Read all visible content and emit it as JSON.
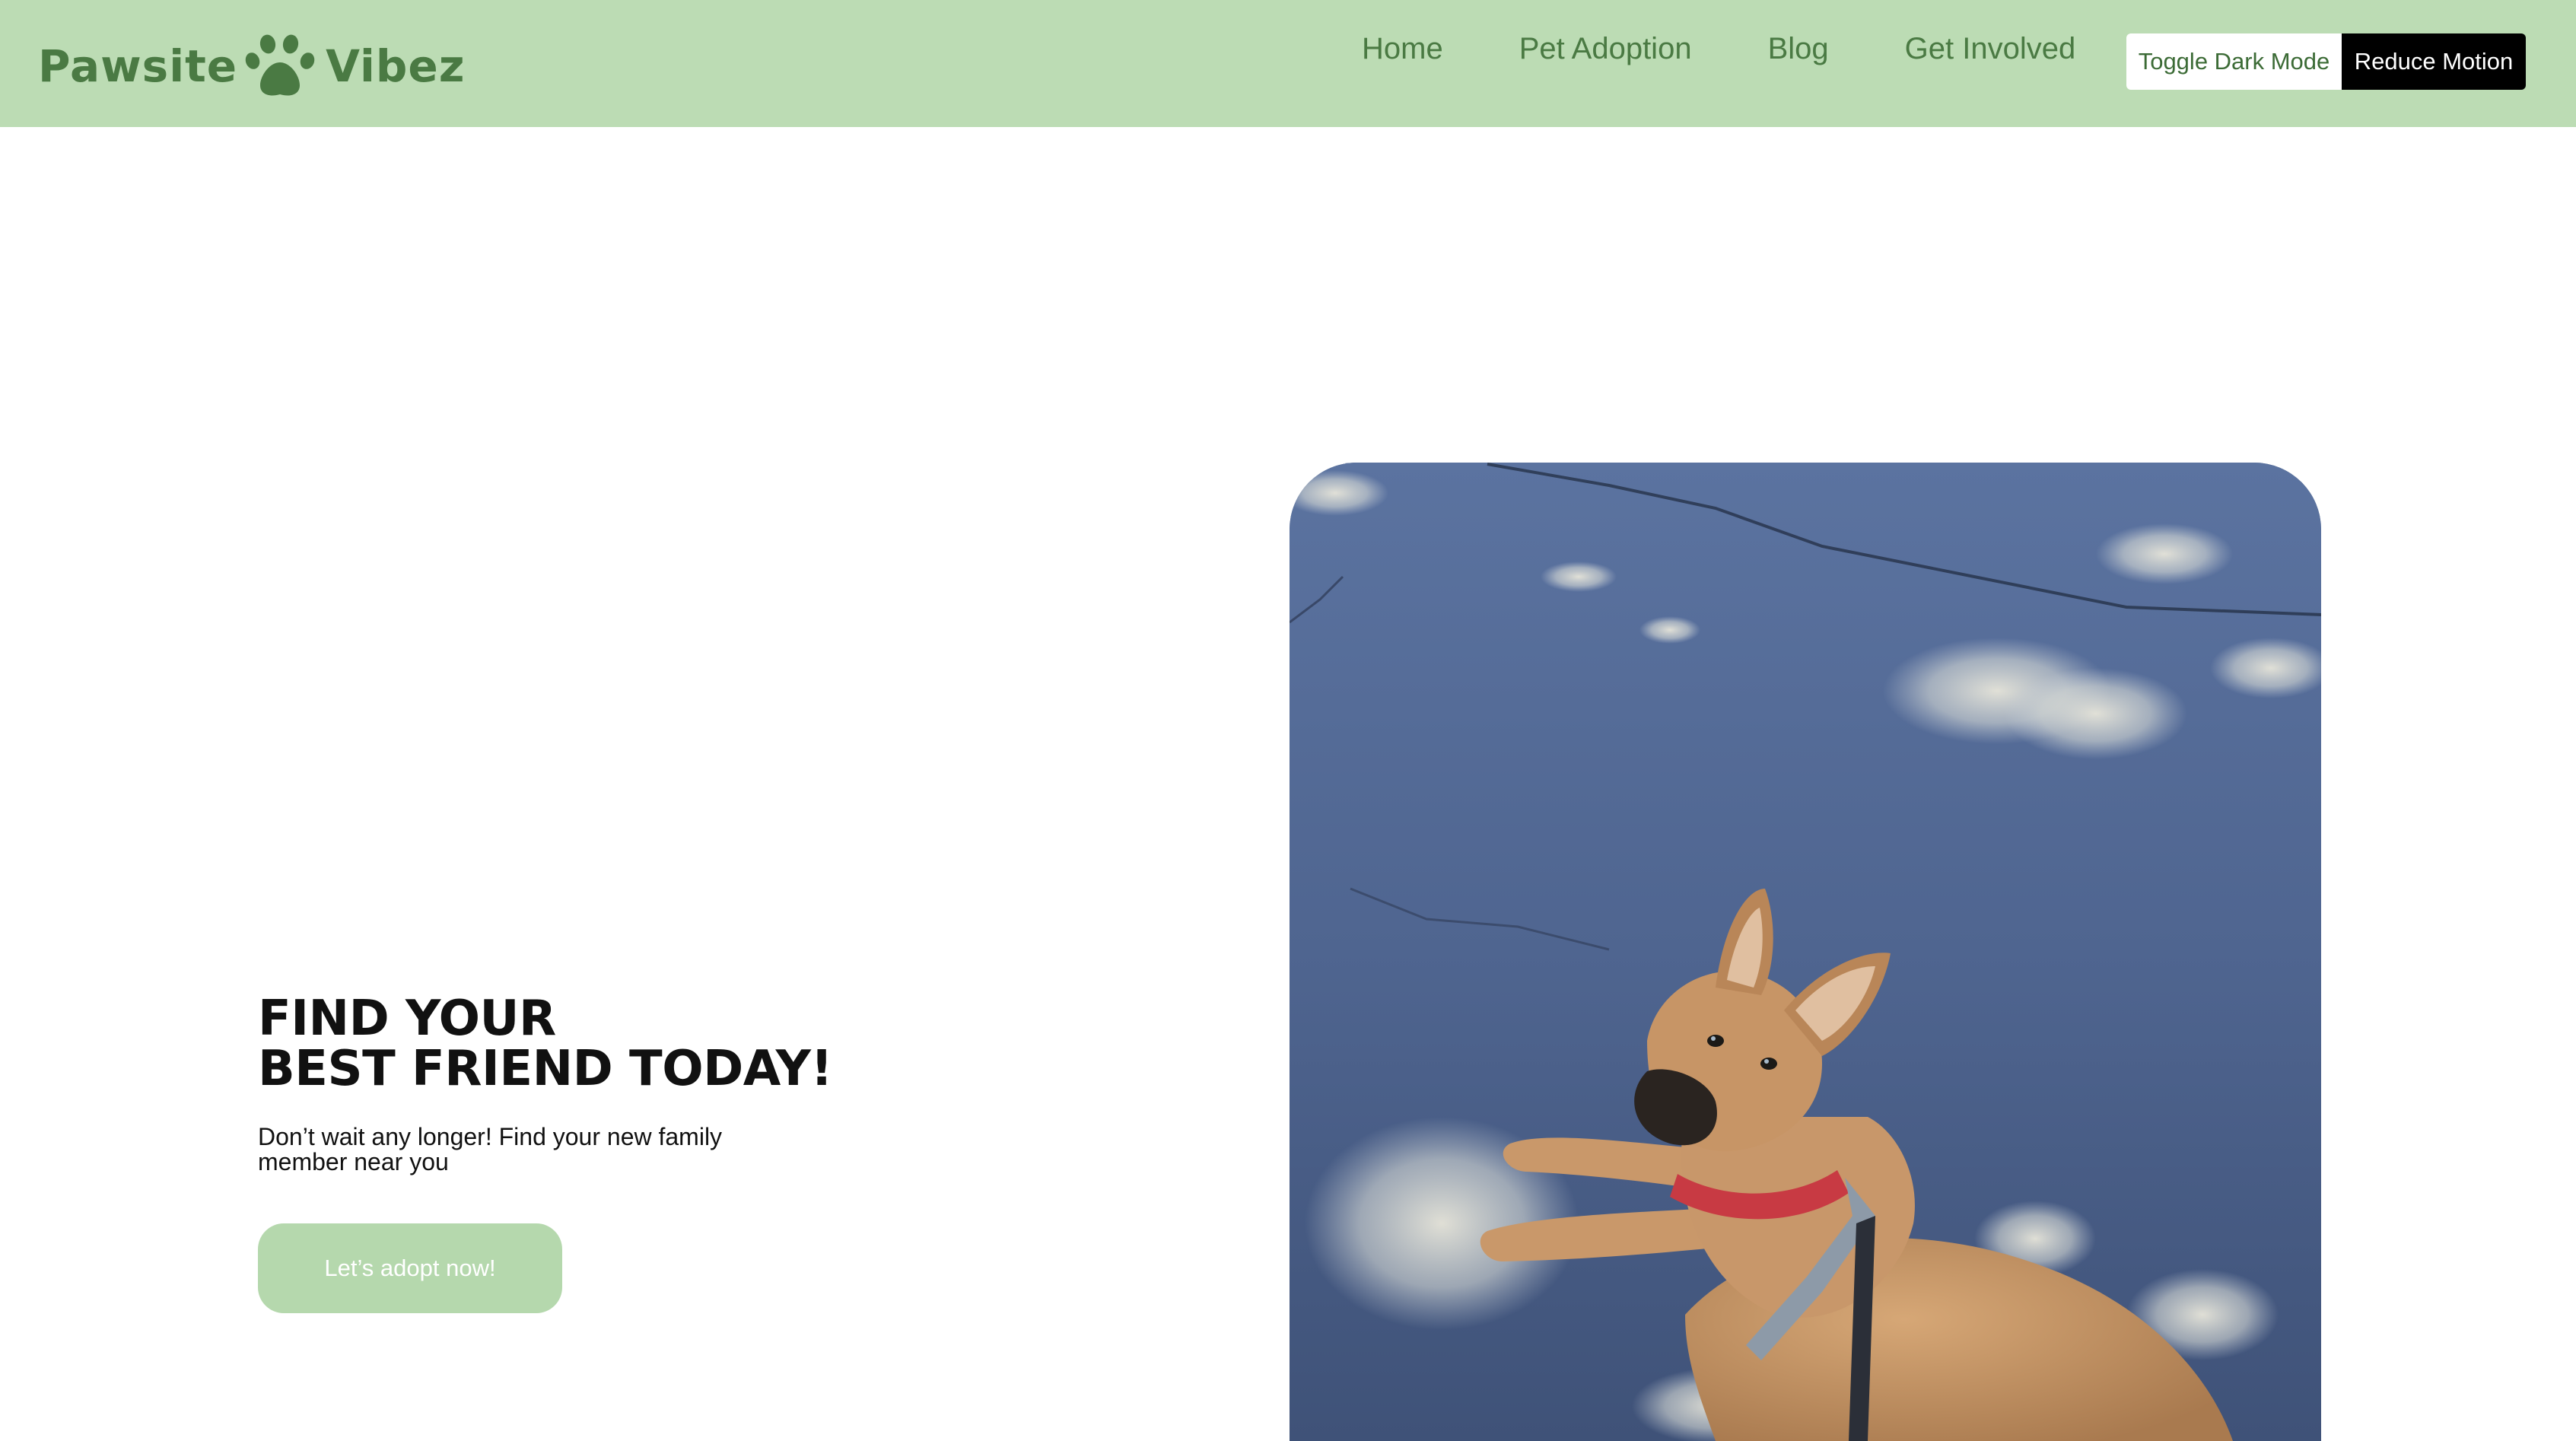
{
  "header": {
    "logo": {
      "word_left": "Pawsite",
      "word_right": "Vibez",
      "icon": "paw-icon",
      "color": "#4a7a43"
    },
    "nav": [
      "Home",
      "Pet Adoption",
      "Blog",
      "Get Involved"
    ],
    "toggle_dark_label": "Toggle Dark Mode",
    "reduce_motion_label": "Reduce Motion",
    "background": "#bcdcb4"
  },
  "hero": {
    "title_line1": "FIND YOUR",
    "title_line2": "BEST FRIEND TODAY!",
    "subtitle": "Don’t wait any longer! Find your new family member near you",
    "cta_label": "Let’s adopt now!",
    "cta_color": "#b5d8ad"
  },
  "photo": {
    "subject": "dog-photo"
  }
}
